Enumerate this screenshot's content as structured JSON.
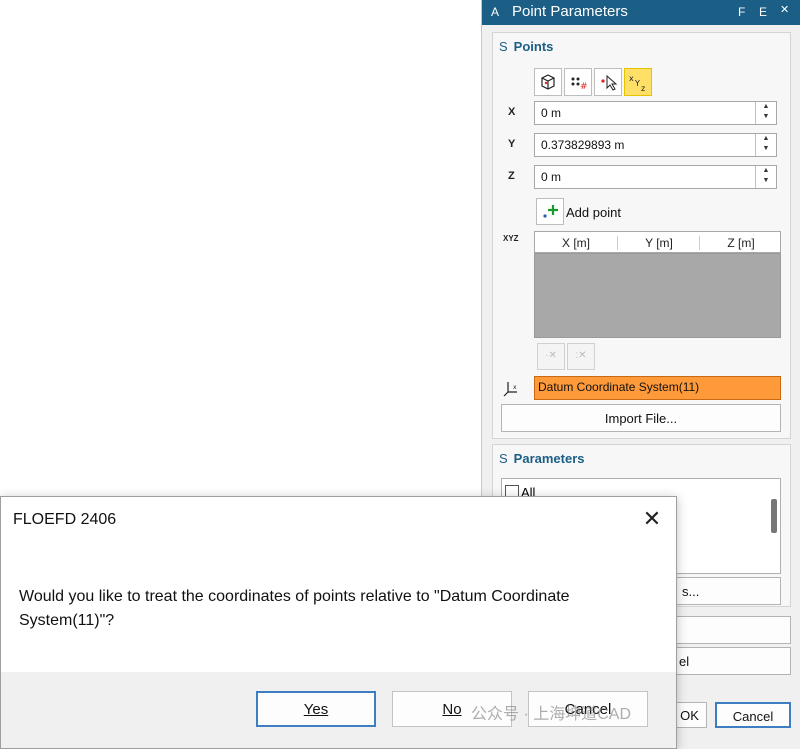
{
  "panel": {
    "title": "Point Parameters",
    "title_prefix": "A",
    "title_f": "F",
    "title_e": "E",
    "points_section": {
      "prefix": "S",
      "title": "Points"
    },
    "toolbar": [
      "select-on-model",
      "points-pattern",
      "pick-point",
      "xyz-coordinates"
    ],
    "x": {
      "label": "X",
      "value": "0 m"
    },
    "y": {
      "label": "Y",
      "value": "0.373829893 m"
    },
    "z": {
      "label": "Z",
      "value": "0 m"
    },
    "add_point": "Add point",
    "xyz_label": "XYZ",
    "table": {
      "headers": [
        "X [m]",
        "Y [m]",
        "Z [m]"
      ],
      "rows": []
    },
    "coordinate_system": "Datum Coordinate System(11)",
    "import_file": "Import File...",
    "parameters_section": {
      "prefix": "S",
      "title": "Parameters"
    },
    "all_label": "All",
    "partial_button": "s...",
    "ok": "OK",
    "cancel": "Cancel",
    "partial_el": "el"
  },
  "dialog": {
    "title": "FLOEFD 2406",
    "message": "Would you like to treat the coordinates of points relative to \"Datum Coordinate System(11)\"?",
    "buttons": {
      "yes": "Yes",
      "no": "No",
      "cancel": "Cancel"
    }
  },
  "watermark": "公众号 · 上海坤道CAD",
  "colors": {
    "accent": "#1b5e86",
    "highlight": "#ff9a3a",
    "active_tool": "#ffe066"
  }
}
